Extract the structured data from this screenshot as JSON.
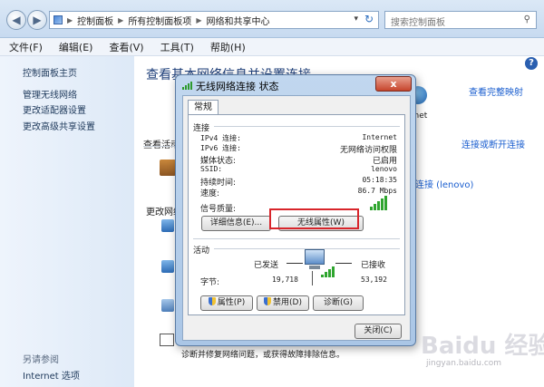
{
  "breadcrumb": {
    "items": [
      "控制面板",
      "所有控制面板项",
      "网络和共享中心"
    ]
  },
  "search": {
    "placeholder": "搜索控制面板"
  },
  "menu": {
    "items": [
      "文件(F)",
      "编辑(E)",
      "查看(V)",
      "工具(T)",
      "帮助(H)"
    ]
  },
  "sidebar": {
    "home": "控制面板主页",
    "items": [
      "管理无线网络",
      "更改适配器设置",
      "更改高级共享设置"
    ],
    "see_also_title": "另请参阅",
    "see_also_items": [
      "Internet 选项"
    ]
  },
  "main": {
    "heading": "查看基本网络信息并设置连接",
    "view_full_map": "查看完整映射",
    "internet_partial": "rnet",
    "active_label": "查看活动",
    "connect_disconnect": "连接或断开连接",
    "access_type_partial": "t",
    "conn_name": "连接 (lenovo)",
    "change_label": "更改网络",
    "troubleshoot_text": "诊断并修复网络问题，或获得故障排除信息。"
  },
  "dialog": {
    "title": "无线网络连接 状态",
    "close_glyph": "x",
    "tab": "常规",
    "connection": {
      "group": "连接",
      "rows": [
        {
          "label": "IPv4 连接:",
          "value": "Internet"
        },
        {
          "label": "IPv6 连接:",
          "value": "无网络访问权限"
        },
        {
          "label": "媒体状态:",
          "value": "已启用"
        },
        {
          "label": "SSID:",
          "value": "lenovo"
        },
        {
          "label": "持续时间:",
          "value": "05:18:35"
        },
        {
          "label": "速度:",
          "value": "86.7 Mbps"
        }
      ],
      "signal_label": "信号质量:",
      "details_button": "详细信息(E)...",
      "wireless_props_button": "无线属性(W)"
    },
    "activity": {
      "group": "活动",
      "sent_label": "已发送",
      "received_label": "已接收",
      "bytes_label": "字节:",
      "sent_value": "19,718",
      "received_value": "53,192"
    },
    "buttons": {
      "properties": "属性(P)",
      "disable": "禁用(D)",
      "diagnose": "诊断(G)",
      "close": "关闭(C)"
    }
  },
  "watermark": {
    "text": "Baidu 经验",
    "sub": "jingyan.baidu.com"
  },
  "colors": {
    "accent_link": "#1a5ecf",
    "highlight_box": "#d8252b",
    "signal": "#2fa52f"
  }
}
